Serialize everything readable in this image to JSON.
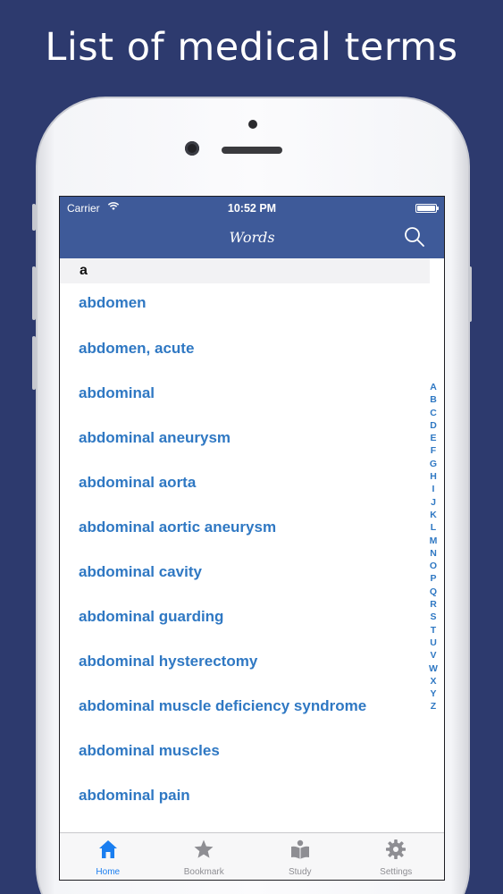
{
  "headline": "List of medical terms",
  "status_bar": {
    "carrier": "Carrier",
    "time": "10:52 PM"
  },
  "nav": {
    "title": "Words",
    "search_icon": "search-icon"
  },
  "section_header": "a",
  "words": [
    "abdomen",
    "abdomen, acute",
    "abdominal",
    "abdominal aneurysm",
    "abdominal aorta",
    "abdominal aortic aneurysm",
    "abdominal cavity",
    "abdominal guarding",
    "abdominal hysterectomy",
    "abdominal muscle deficiency syndrome",
    "abdominal muscles",
    "abdominal pain"
  ],
  "index_letters": [
    "A",
    "B",
    "C",
    "D",
    "E",
    "F",
    "G",
    "H",
    "I",
    "J",
    "K",
    "L",
    "M",
    "N",
    "O",
    "P",
    "Q",
    "R",
    "S",
    "T",
    "U",
    "V",
    "W",
    "X",
    "Y",
    "Z"
  ],
  "tabs": [
    {
      "label": "Home",
      "icon": "home-icon",
      "active": true
    },
    {
      "label": "Bookmark",
      "icon": "star-icon",
      "active": false
    },
    {
      "label": "Study",
      "icon": "study-book-icon",
      "active": false
    },
    {
      "label": "Settings",
      "icon": "gear-icon",
      "active": false
    }
  ],
  "colors": {
    "background": "#2d3a6e",
    "navbar": "#3e5a99",
    "link": "#2f78c3",
    "tab_active": "#1a7ef0",
    "tab_inactive": "#8e8e93"
  }
}
